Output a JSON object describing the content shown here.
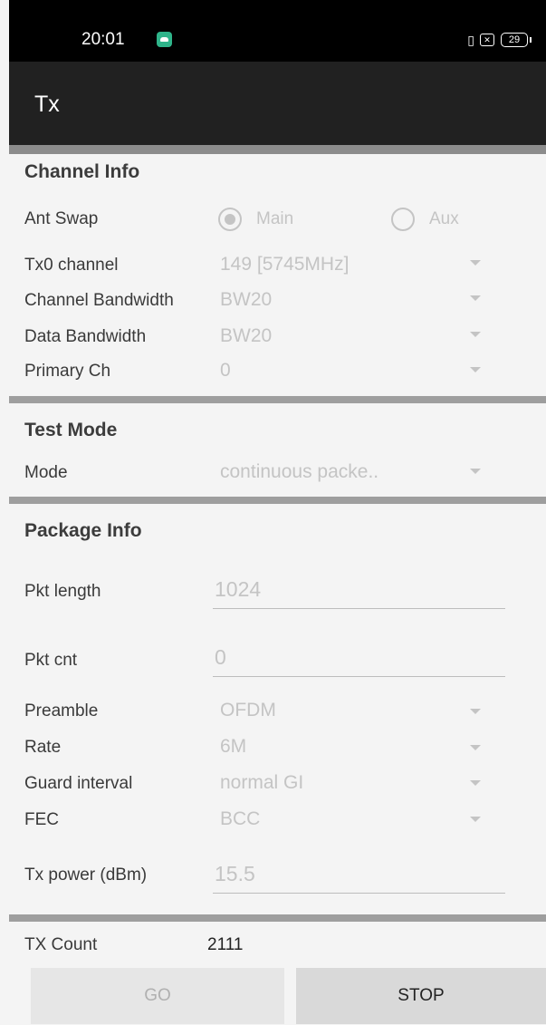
{
  "status_bar": {
    "time": "20:01",
    "app_icon": "android-icon",
    "icons": {
      "vibrate": "vibrate-icon",
      "no_sim": "✕",
      "battery": "29"
    }
  },
  "app_bar": {
    "title": "Tx"
  },
  "channel_info": {
    "title": "Channel Info",
    "ant_swap": {
      "label": "Ant Swap",
      "options": [
        "Main",
        "Aux"
      ],
      "selected": "Main"
    },
    "tx0_channel": {
      "label": "Tx0 channel",
      "value": "149 [5745MHz]"
    },
    "channel_bandwidth": {
      "label": "Channel Bandwidth",
      "value": "BW20"
    },
    "data_bandwidth": {
      "label": "Data Bandwidth",
      "value": "BW20"
    },
    "primary_ch": {
      "label": "Primary Ch",
      "value": "0"
    }
  },
  "test_mode": {
    "title": "Test Mode",
    "mode": {
      "label": "Mode",
      "value": "continuous packe.."
    }
  },
  "package_info": {
    "title": "Package Info",
    "pkt_length": {
      "label": "Pkt length",
      "value": "1024"
    },
    "pkt_cnt": {
      "label": "Pkt cnt",
      "value": "0"
    },
    "preamble": {
      "label": "Preamble",
      "value": "OFDM"
    },
    "rate": {
      "label": "Rate",
      "value": "6M"
    },
    "guard_interval": {
      "label": "Guard interval",
      "value": "normal GI"
    },
    "fec": {
      "label": "FEC",
      "value": "BCC"
    },
    "tx_power": {
      "label": "Tx power (dBm)",
      "value": "15.5"
    }
  },
  "tx_count": {
    "label": "TX Count",
    "value": "2111"
  },
  "buttons": {
    "go": "GO",
    "stop": "STOP"
  },
  "colors": {
    "disabled_text": "#c4c4c4",
    "app_bar": "#212121",
    "divider": "#9e9e9e"
  }
}
